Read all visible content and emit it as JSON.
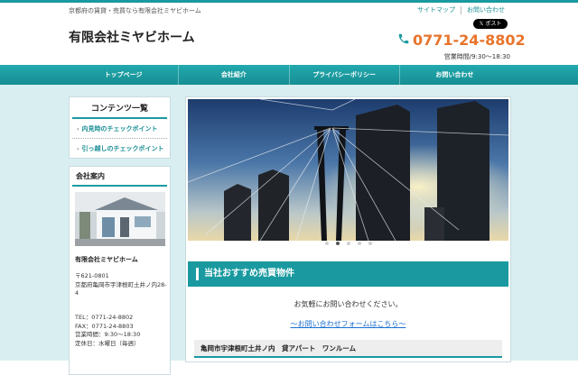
{
  "header": {
    "tagline": "京都府の賃貸・売買なら有限会社ミヤビホーム",
    "links": [
      "サイトマップ",
      "お問い合わせ"
    ],
    "x_post_label": "ポスト",
    "site_title": "有限会社ミヤビホーム",
    "phone": "0771-24-8802",
    "hours": "営業時間/9:30〜18:30",
    "phone_color": "#e8742b"
  },
  "nav": {
    "items": [
      "トップページ",
      "会社紹介",
      "プライバシーポリシー",
      "お問い合わせ"
    ]
  },
  "sidebar": {
    "menu_title": "コンテンツ一覧",
    "menu_items": [
      "内見時のチェックポイント",
      "引っ越しのチェックポイント"
    ],
    "company": {
      "title": "会社案内",
      "name": "有限会社ミヤビホーム",
      "postal": "〒621-0801",
      "address": "京都府亀岡市宇津根町土井ノ内28-4",
      "tel": "TEL：0771-24-8802",
      "fax": "FAX：0771-24-8803",
      "hours": "営業時間：9:30〜18:30",
      "holiday": "定休日：水曜日（毎週）"
    }
  },
  "main": {
    "slider_dots": 5,
    "slider_active": 1,
    "section_title": "当社おすすめ売買物件",
    "inquiry_text": "お気軽にお問い合わせください。",
    "inquiry_link": "〜お問い合わせフォームはこちら〜",
    "listing_title": "亀岡市宇津根町土井ノ内　貸アパート　ワンルーム"
  },
  "colors": {
    "accent": "#1a9aa0",
    "background": "#d9eef0",
    "link": "#1a6ed0"
  }
}
